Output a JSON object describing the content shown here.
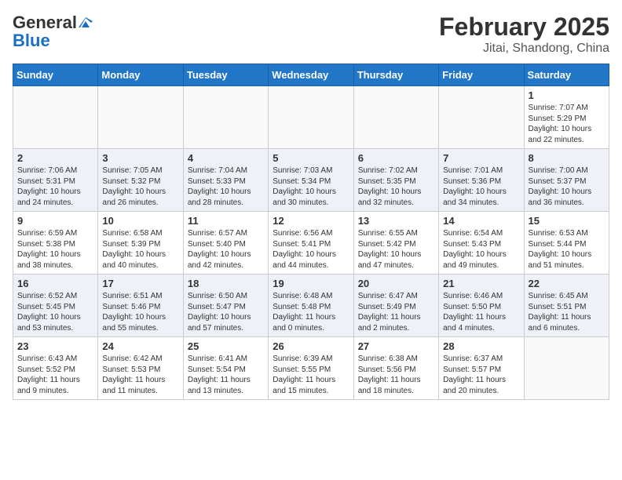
{
  "header": {
    "logo_general": "General",
    "logo_blue": "Blue",
    "month": "February 2025",
    "location": "Jitai, Shandong, China"
  },
  "weekdays": [
    "Sunday",
    "Monday",
    "Tuesday",
    "Wednesday",
    "Thursday",
    "Friday",
    "Saturday"
  ],
  "weeks": [
    [
      {
        "day": "",
        "info": ""
      },
      {
        "day": "",
        "info": ""
      },
      {
        "day": "",
        "info": ""
      },
      {
        "day": "",
        "info": ""
      },
      {
        "day": "",
        "info": ""
      },
      {
        "day": "",
        "info": ""
      },
      {
        "day": "1",
        "info": "Sunrise: 7:07 AM\nSunset: 5:29 PM\nDaylight: 10 hours and 22 minutes."
      }
    ],
    [
      {
        "day": "2",
        "info": "Sunrise: 7:06 AM\nSunset: 5:31 PM\nDaylight: 10 hours and 24 minutes."
      },
      {
        "day": "3",
        "info": "Sunrise: 7:05 AM\nSunset: 5:32 PM\nDaylight: 10 hours and 26 minutes."
      },
      {
        "day": "4",
        "info": "Sunrise: 7:04 AM\nSunset: 5:33 PM\nDaylight: 10 hours and 28 minutes."
      },
      {
        "day": "5",
        "info": "Sunrise: 7:03 AM\nSunset: 5:34 PM\nDaylight: 10 hours and 30 minutes."
      },
      {
        "day": "6",
        "info": "Sunrise: 7:02 AM\nSunset: 5:35 PM\nDaylight: 10 hours and 32 minutes."
      },
      {
        "day": "7",
        "info": "Sunrise: 7:01 AM\nSunset: 5:36 PM\nDaylight: 10 hours and 34 minutes."
      },
      {
        "day": "8",
        "info": "Sunrise: 7:00 AM\nSunset: 5:37 PM\nDaylight: 10 hours and 36 minutes."
      }
    ],
    [
      {
        "day": "9",
        "info": "Sunrise: 6:59 AM\nSunset: 5:38 PM\nDaylight: 10 hours and 38 minutes."
      },
      {
        "day": "10",
        "info": "Sunrise: 6:58 AM\nSunset: 5:39 PM\nDaylight: 10 hours and 40 minutes."
      },
      {
        "day": "11",
        "info": "Sunrise: 6:57 AM\nSunset: 5:40 PM\nDaylight: 10 hours and 42 minutes."
      },
      {
        "day": "12",
        "info": "Sunrise: 6:56 AM\nSunset: 5:41 PM\nDaylight: 10 hours and 44 minutes."
      },
      {
        "day": "13",
        "info": "Sunrise: 6:55 AM\nSunset: 5:42 PM\nDaylight: 10 hours and 47 minutes."
      },
      {
        "day": "14",
        "info": "Sunrise: 6:54 AM\nSunset: 5:43 PM\nDaylight: 10 hours and 49 minutes."
      },
      {
        "day": "15",
        "info": "Sunrise: 6:53 AM\nSunset: 5:44 PM\nDaylight: 10 hours and 51 minutes."
      }
    ],
    [
      {
        "day": "16",
        "info": "Sunrise: 6:52 AM\nSunset: 5:45 PM\nDaylight: 10 hours and 53 minutes."
      },
      {
        "day": "17",
        "info": "Sunrise: 6:51 AM\nSunset: 5:46 PM\nDaylight: 10 hours and 55 minutes."
      },
      {
        "day": "18",
        "info": "Sunrise: 6:50 AM\nSunset: 5:47 PM\nDaylight: 10 hours and 57 minutes."
      },
      {
        "day": "19",
        "info": "Sunrise: 6:48 AM\nSunset: 5:48 PM\nDaylight: 11 hours and 0 minutes."
      },
      {
        "day": "20",
        "info": "Sunrise: 6:47 AM\nSunset: 5:49 PM\nDaylight: 11 hours and 2 minutes."
      },
      {
        "day": "21",
        "info": "Sunrise: 6:46 AM\nSunset: 5:50 PM\nDaylight: 11 hours and 4 minutes."
      },
      {
        "day": "22",
        "info": "Sunrise: 6:45 AM\nSunset: 5:51 PM\nDaylight: 11 hours and 6 minutes."
      }
    ],
    [
      {
        "day": "23",
        "info": "Sunrise: 6:43 AM\nSunset: 5:52 PM\nDaylight: 11 hours and 9 minutes."
      },
      {
        "day": "24",
        "info": "Sunrise: 6:42 AM\nSunset: 5:53 PM\nDaylight: 11 hours and 11 minutes."
      },
      {
        "day": "25",
        "info": "Sunrise: 6:41 AM\nSunset: 5:54 PM\nDaylight: 11 hours and 13 minutes."
      },
      {
        "day": "26",
        "info": "Sunrise: 6:39 AM\nSunset: 5:55 PM\nDaylight: 11 hours and 15 minutes."
      },
      {
        "day": "27",
        "info": "Sunrise: 6:38 AM\nSunset: 5:56 PM\nDaylight: 11 hours and 18 minutes."
      },
      {
        "day": "28",
        "info": "Sunrise: 6:37 AM\nSunset: 5:57 PM\nDaylight: 11 hours and 20 minutes."
      },
      {
        "day": "",
        "info": ""
      }
    ]
  ]
}
